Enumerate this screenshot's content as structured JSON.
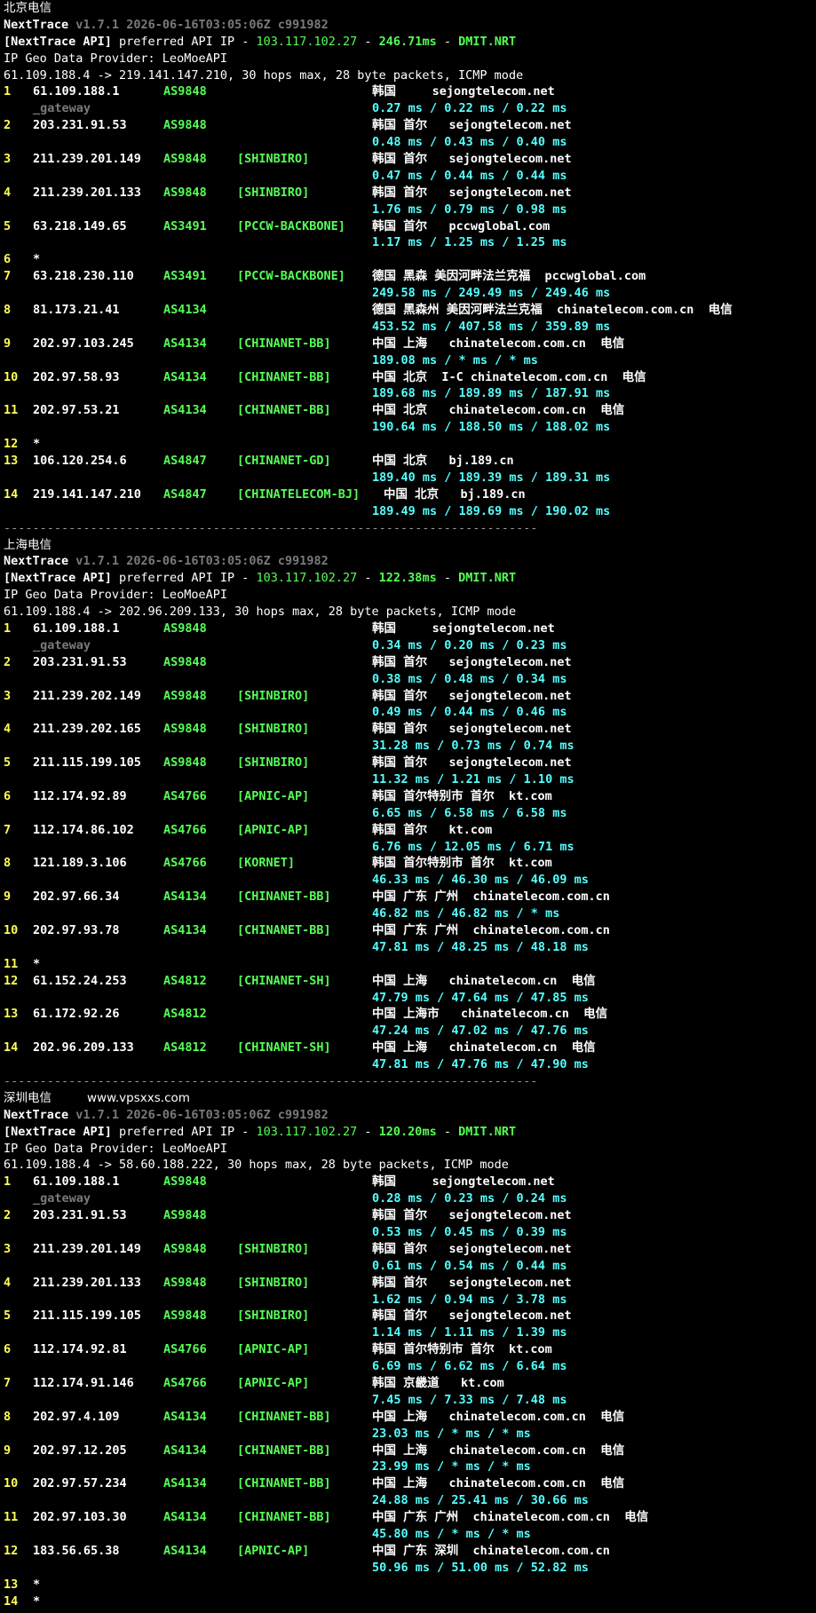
{
  "sections": [
    {
      "header": "北京电信",
      "header_extra": "",
      "version": "v1.7.1 2026-06-16T03:05:06Z c991982",
      "api_ip": "103.117.102.27",
      "api_latency": "246.71ms",
      "api_node": "DMIT.NRT",
      "geo_provider": "IP Geo Data Provider: LeoMoeAPI",
      "trace_line": "61.109.188.4 -> 219.141.147.210, 30 hops max, 28 byte packets, ICMP mode",
      "hops": [
        {
          "hop": "1",
          "ip": "61.109.188.1",
          "asn": "AS9848",
          "tag": "",
          "geo": "韩国     sejongtelecom.net",
          "rtt": "0.27 ms / 0.22 ms / 0.22 ms",
          "gateway": "_gateway"
        },
        {
          "hop": "2",
          "ip": "203.231.91.53",
          "asn": "AS9848",
          "tag": "",
          "geo": "韩国 首尔   sejongtelecom.net",
          "rtt": "0.48 ms / 0.43 ms / 0.40 ms"
        },
        {
          "hop": "3",
          "ip": "211.239.201.149",
          "asn": "AS9848",
          "tag": "[SHINBIRO]",
          "geo": "韩国 首尔   sejongtelecom.net",
          "rtt": "0.47 ms / 0.44 ms / 0.44 ms"
        },
        {
          "hop": "4",
          "ip": "211.239.201.133",
          "asn": "AS9848",
          "tag": "[SHINBIRO]",
          "geo": "韩国 首尔   sejongtelecom.net",
          "rtt": "1.76 ms / 0.79 ms / 0.98 ms"
        },
        {
          "hop": "5",
          "ip": "63.218.149.65",
          "asn": "AS3491",
          "tag": "[PCCW-BACKBONE]",
          "geo": "韩国 首尔   pccwglobal.com",
          "rtt": "1.17 ms / 1.25 ms / 1.25 ms"
        },
        {
          "hop": "6",
          "ip": "*",
          "star": true
        },
        {
          "hop": "7",
          "ip": "63.218.230.110",
          "asn": "AS3491",
          "tag": "[PCCW-BACKBONE]",
          "geo": "德国 黑森 美因河畔法兰克福  pccwglobal.com",
          "rtt": "249.58 ms / 249.49 ms / 249.46 ms"
        },
        {
          "hop": "8",
          "ip": "81.173.21.41",
          "asn": "AS4134",
          "tag": "",
          "geo": "德国 黑森州 美因河畔法兰克福  chinatelecom.com.cn  电信",
          "rtt": "453.52 ms / 407.58 ms / 359.89 ms"
        },
        {
          "hop": "9",
          "ip": "202.97.103.245",
          "asn": "AS4134",
          "tag": "[CHINANET-BB]",
          "geo": "中国 上海   chinatelecom.com.cn  电信",
          "rtt": "189.08 ms / * ms / * ms"
        },
        {
          "hop": "10",
          "ip": "202.97.58.93",
          "asn": "AS4134",
          "tag": "[CHINANET-BB]",
          "geo": "中国 北京  I-C chinatelecom.com.cn  电信",
          "rtt": "189.68 ms / 189.89 ms / 187.91 ms"
        },
        {
          "hop": "11",
          "ip": "202.97.53.21",
          "asn": "AS4134",
          "tag": "[CHINANET-BB]",
          "geo": "中国 北京   chinatelecom.com.cn  电信",
          "rtt": "190.64 ms / 188.50 ms / 188.02 ms"
        },
        {
          "hop": "12",
          "ip": "*",
          "star": true
        },
        {
          "hop": "13",
          "ip": "106.120.254.6",
          "asn": "AS4847",
          "tag": "[CHINANET-GD]",
          "geo": "中国 北京   bj.189.cn",
          "rtt": "189.40 ms / 189.39 ms / 189.31 ms"
        },
        {
          "hop": "14",
          "ip": "219.141.147.210",
          "asn": "AS4847",
          "tag": "[CHINATELECOM-BJ]",
          "geo": "中国 北京   bj.189.cn",
          "rtt": "189.49 ms / 189.69 ms / 190.02 ms",
          "geo_offset": true
        }
      ]
    },
    {
      "header": "上海电信",
      "header_extra": "",
      "version": "v1.7.1 2026-06-16T03:05:06Z c991982",
      "api_ip": "103.117.102.27",
      "api_latency": "122.38ms",
      "api_node": "DMIT.NRT",
      "geo_provider": "IP Geo Data Provider: LeoMoeAPI",
      "trace_line": "61.109.188.4 -> 202.96.209.133, 30 hops max, 28 byte packets, ICMP mode",
      "hops": [
        {
          "hop": "1",
          "ip": "61.109.188.1",
          "asn": "AS9848",
          "tag": "",
          "geo": "韩国     sejongtelecom.net",
          "rtt": "0.34 ms / 0.20 ms / 0.23 ms",
          "gateway": "_gateway"
        },
        {
          "hop": "2",
          "ip": "203.231.91.53",
          "asn": "AS9848",
          "tag": "",
          "geo": "韩国 首尔   sejongtelecom.net",
          "rtt": "0.38 ms / 0.48 ms / 0.34 ms"
        },
        {
          "hop": "3",
          "ip": "211.239.202.149",
          "asn": "AS9848",
          "tag": "[SHINBIRO]",
          "geo": "韩国 首尔   sejongtelecom.net",
          "rtt": "0.49 ms / 0.44 ms / 0.46 ms"
        },
        {
          "hop": "4",
          "ip": "211.239.202.165",
          "asn": "AS9848",
          "tag": "[SHINBIRO]",
          "geo": "韩国 首尔   sejongtelecom.net",
          "rtt": "31.28 ms / 0.73 ms / 0.74 ms"
        },
        {
          "hop": "5",
          "ip": "211.115.199.105",
          "asn": "AS9848",
          "tag": "[SHINBIRO]",
          "geo": "韩国 首尔   sejongtelecom.net",
          "rtt": "11.32 ms / 1.21 ms / 1.10 ms"
        },
        {
          "hop": "6",
          "ip": "112.174.92.89",
          "asn": "AS4766",
          "tag": "[APNIC-AP]",
          "geo": "韩国 首尔特别市 首尔  kt.com",
          "rtt": "6.65 ms / 6.58 ms / 6.58 ms"
        },
        {
          "hop": "7",
          "ip": "112.174.86.102",
          "asn": "AS4766",
          "tag": "[APNIC-AP]",
          "geo": "韩国 首尔   kt.com",
          "rtt": "6.76 ms / 12.05 ms / 6.71 ms"
        },
        {
          "hop": "8",
          "ip": "121.189.3.106",
          "asn": "AS4766",
          "tag": "[KORNET]",
          "geo": "韩国 首尔特别市 首尔  kt.com",
          "rtt": "46.33 ms / 46.30 ms / 46.09 ms"
        },
        {
          "hop": "9",
          "ip": "202.97.66.34",
          "asn": "AS4134",
          "tag": "[CHINANET-BB]",
          "geo": "中国 广东 广州  chinatelecom.com.cn",
          "rtt": "46.82 ms / 46.82 ms / * ms"
        },
        {
          "hop": "10",
          "ip": "202.97.93.78",
          "asn": "AS4134",
          "tag": "[CHINANET-BB]",
          "geo": "中国 广东 广州  chinatelecom.com.cn",
          "rtt": "47.81 ms / 48.25 ms / 48.18 ms"
        },
        {
          "hop": "11",
          "ip": "*",
          "star": true
        },
        {
          "hop": "12",
          "ip": "61.152.24.253",
          "asn": "AS4812",
          "tag": "[CHINANET-SH]",
          "geo": "中国 上海   chinatelecom.cn  电信",
          "rtt": "47.79 ms / 47.64 ms / 47.85 ms"
        },
        {
          "hop": "13",
          "ip": "61.172.92.26",
          "asn": "AS4812",
          "tag": "",
          "geo": "中国 上海市   chinatelecom.cn  电信",
          "rtt": "47.24 ms / 47.02 ms / 47.76 ms"
        },
        {
          "hop": "14",
          "ip": "202.96.209.133",
          "asn": "AS4812",
          "tag": "[CHINANET-SH]",
          "geo": "中国 上海   chinatelecom.cn  电信",
          "rtt": "47.81 ms / 47.76 ms / 47.90 ms"
        }
      ]
    },
    {
      "header": "深圳电信",
      "header_extra": "www.vpsxxs.com",
      "version": "v1.7.1 2026-06-16T03:05:06Z c991982",
      "api_ip": "103.117.102.27",
      "api_latency": "120.20ms",
      "api_node": "DMIT.NRT",
      "geo_provider": "IP Geo Data Provider: LeoMoeAPI",
      "trace_line": "61.109.188.4 -> 58.60.188.222, 30 hops max, 28 byte packets, ICMP mode",
      "hops": [
        {
          "hop": "1",
          "ip": "61.109.188.1",
          "asn": "AS9848",
          "tag": "",
          "geo": "韩国     sejongtelecom.net",
          "rtt": "0.28 ms / 0.23 ms / 0.24 ms",
          "gateway": "_gateway"
        },
        {
          "hop": "2",
          "ip": "203.231.91.53",
          "asn": "AS9848",
          "tag": "",
          "geo": "韩国 首尔   sejongtelecom.net",
          "rtt": "0.53 ms / 0.45 ms / 0.39 ms"
        },
        {
          "hop": "3",
          "ip": "211.239.201.149",
          "asn": "AS9848",
          "tag": "[SHINBIRO]",
          "geo": "韩国 首尔   sejongtelecom.net",
          "rtt": "0.61 ms / 0.54 ms / 0.44 ms"
        },
        {
          "hop": "4",
          "ip": "211.239.201.133",
          "asn": "AS9848",
          "tag": "[SHINBIRO]",
          "geo": "韩国 首尔   sejongtelecom.net",
          "rtt": "1.62 ms / 0.94 ms / 3.78 ms"
        },
        {
          "hop": "5",
          "ip": "211.115.199.105",
          "asn": "AS9848",
          "tag": "[SHINBIRO]",
          "geo": "韩国 首尔   sejongtelecom.net",
          "rtt": "1.14 ms / 1.11 ms / 1.39 ms"
        },
        {
          "hop": "6",
          "ip": "112.174.92.81",
          "asn": "AS4766",
          "tag": "[APNIC-AP]",
          "geo": "韩国 首尔特别市 首尔  kt.com",
          "rtt": "6.69 ms / 6.62 ms / 6.64 ms"
        },
        {
          "hop": "7",
          "ip": "112.174.91.146",
          "asn": "AS4766",
          "tag": "[APNIC-AP]",
          "geo": "韩国 京畿道   kt.com",
          "rtt": "7.45 ms / 7.33 ms / 7.48 ms"
        },
        {
          "hop": "8",
          "ip": "202.97.4.109",
          "asn": "AS4134",
          "tag": "[CHINANET-BB]",
          "geo": "中国 上海   chinatelecom.com.cn  电信",
          "rtt": "23.03 ms / * ms / * ms"
        },
        {
          "hop": "9",
          "ip": "202.97.12.205",
          "asn": "AS4134",
          "tag": "[CHINANET-BB]",
          "geo": "中国 上海   chinatelecom.com.cn  电信",
          "rtt": "23.99 ms / * ms / * ms"
        },
        {
          "hop": "10",
          "ip": "202.97.57.234",
          "asn": "AS4134",
          "tag": "[CHINANET-BB]",
          "geo": "中国 上海   chinatelecom.com.cn  电信",
          "rtt": "24.88 ms / 25.41 ms / 30.66 ms"
        },
        {
          "hop": "11",
          "ip": "202.97.103.30",
          "asn": "AS4134",
          "tag": "[CHINANET-BB]",
          "geo": "中国 广东 广州  chinatelecom.com.cn  电信",
          "rtt": "45.80 ms / * ms / * ms"
        },
        {
          "hop": "12",
          "ip": "183.56.65.38",
          "asn": "AS4134",
          "tag": "[APNIC-AP]",
          "geo": "中国 广东 深圳  chinatelecom.com.cn",
          "rtt": "50.96 ms / 51.00 ms / 52.82 ms"
        },
        {
          "hop": "13",
          "ip": "*",
          "star": true
        },
        {
          "hop": "14",
          "ip": "*",
          "star": true
        }
      ]
    }
  ],
  "labels": {
    "nexttrace": "NextTrace",
    "api_prefix": "[NextTrace API]",
    "api_preferred": " preferred API IP - ",
    "dash": " - "
  },
  "separator": "--------------------------------------------------------------------------"
}
